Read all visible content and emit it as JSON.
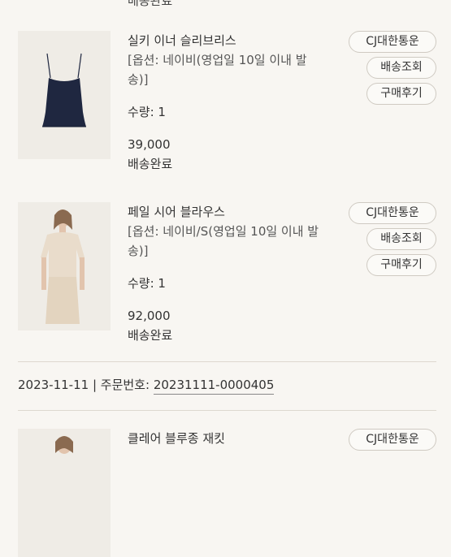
{
  "top_status": "배송완료",
  "items": [
    {
      "name": "실키 이너 슬리브리스",
      "option": "[옵션: 네이비(영업일 10일 이내 발송)]",
      "qty": "수량: 1",
      "price": "39,000",
      "status": "배송완료",
      "carrier": "CJ대한통운",
      "track": "배송조회",
      "review": "구매후기",
      "image_icon": "navy-camisole-image"
    },
    {
      "name": "페일 시어 블라우스",
      "option": "[옵션: 네이비/S(영업일 10일 이내 발송)]",
      "qty": "수량: 1",
      "price": "92,000",
      "status": "배송완료",
      "carrier": "CJ대한통운",
      "track": "배송조회",
      "review": "구매후기",
      "image_icon": "model-blouse-image"
    },
    {
      "name": "클레어 블루종 재킷",
      "carrier": "CJ대한통운",
      "image_icon": "model-jacket-image"
    }
  ],
  "order": {
    "date": "2023-11-11",
    "sep": " | ",
    "label": "주문번호: ",
    "number": "20231111-0000405"
  },
  "colors": {
    "background": "#f8f6f2",
    "navy": "#1f2740",
    "beige": "#e9dccb"
  }
}
